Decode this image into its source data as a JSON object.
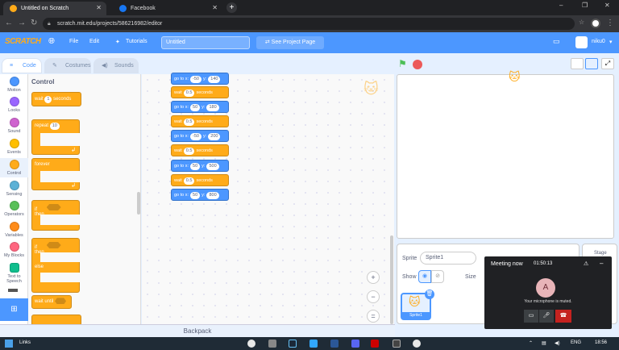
{
  "browser": {
    "tabs": [
      {
        "title": "Untitled on Scratch",
        "active": true
      },
      {
        "title": "Facebook",
        "active": false
      }
    ],
    "new_tab": "+",
    "url": "scratch.mit.edu/projects/586216982/editor",
    "window_controls": [
      "–",
      "❐",
      "✕"
    ]
  },
  "menubar": {
    "logo": "SCRATCH",
    "items": [
      "File",
      "Edit"
    ],
    "tutorials": "Tutorials",
    "project_title": "Untitled",
    "see_project": "See Project Page",
    "username": "niku0"
  },
  "editor_tabs": [
    "Code",
    "Costumes",
    "Sounds"
  ],
  "categories": [
    {
      "label": "Motion",
      "color": "#4c97ff"
    },
    {
      "label": "Looks",
      "color": "#9966ff"
    },
    {
      "label": "Sound",
      "color": "#cf63cf"
    },
    {
      "label": "Events",
      "color": "#ffbf00"
    },
    {
      "label": "Control",
      "color": "#ffab19"
    },
    {
      "label": "Sensing",
      "color": "#5cb1d6"
    },
    {
      "label": "Operators",
      "color": "#59c059"
    },
    {
      "label": "Variables",
      "color": "#ff8c1a"
    },
    {
      "label": "My Blocks",
      "color": "#ff6680"
    },
    {
      "label": "Text to Speech",
      "color": "#0fbd8c"
    }
  ],
  "palette": {
    "title": "Control",
    "wait": {
      "label": "wait",
      "value": "1",
      "unit": "seconds"
    },
    "repeat": {
      "label": "repeat",
      "value": "10"
    },
    "forever": "forever",
    "if_then": {
      "if": "if",
      "then": "then"
    },
    "if_else": {
      "if": "if",
      "then": "then",
      "else": "else"
    },
    "wait_until": "wait until"
  },
  "script": [
    {
      "type": "motion",
      "x": "-50",
      "y": "140"
    },
    {
      "type": "wait",
      "value": "0.5"
    },
    {
      "type": "motion",
      "x": "50",
      "y": "180"
    },
    {
      "type": "wait",
      "value": "0.5"
    },
    {
      "type": "motion",
      "x": "-50",
      "y": "200"
    },
    {
      "type": "wait",
      "value": "0.5"
    },
    {
      "type": "motion",
      "x": "50",
      "y": "500"
    },
    {
      "type": "wait",
      "value": "0.5"
    },
    {
      "type": "motion",
      "x": "50",
      "y": "800"
    }
  ],
  "script_labels": {
    "goto": "go to x:",
    "y": "y:",
    "wait": "wait",
    "seconds": "seconds"
  },
  "zoom": [
    "+",
    "−",
    "="
  ],
  "sprite_pane": {
    "sprite_label": "Sprite",
    "sprite_name": "Sprite1",
    "show_label": "Show",
    "size_label": "Size",
    "thumb_name": "Sprite1"
  },
  "stage_pane": {
    "label": "Stage"
  },
  "meeting": {
    "title": "Meeting now",
    "timer": "01:50:13",
    "avatar": "A",
    "muted_msg": "Your microphone is muted."
  },
  "backpack": "Backpack",
  "taskbar": {
    "links": "Links",
    "lang": "ENG",
    "time": "18:56"
  }
}
